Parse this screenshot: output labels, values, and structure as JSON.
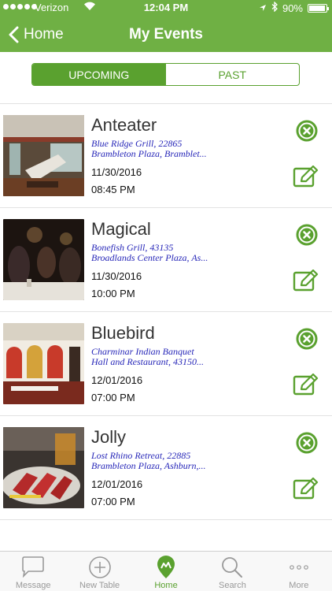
{
  "status_bar": {
    "carrier": "Verizon",
    "time": "12:04 PM",
    "battery": "90%"
  },
  "nav": {
    "back_label": "Home",
    "title": "My Events"
  },
  "segments": {
    "upcoming": "UPCOMING",
    "past": "PAST",
    "selected": "UPCOMING"
  },
  "events": [
    {
      "name": "Anteater",
      "address_line1": "Blue Ridge Grill, 22865",
      "address_line2": "Brambleton Plaza, Bramblet...",
      "date": "11/30/2016",
      "time": "08:45 PM"
    },
    {
      "name": "Magical",
      "address_line1": "Bonefish Grill, 43135",
      "address_line2": "Broadlands Center Plaza, As...",
      "date": "11/30/2016",
      "time": "10:00 PM"
    },
    {
      "name": "Bluebird",
      "address_line1": "Charminar Indian Banquet",
      "address_line2": "Hall and Restaurant, 43150...",
      "date": "12/01/2016",
      "time": "07:00 PM"
    },
    {
      "name": "Jolly",
      "address_line1": "Lost Rhino Retreat, 22885",
      "address_line2": "Brambleton Plaza, Ashburn,...",
      "date": "12/01/2016",
      "time": "07:00 PM"
    }
  ],
  "tabs": [
    {
      "label": "Message",
      "icon": "message-icon"
    },
    {
      "label": "New Table",
      "icon": "plus-circle-icon"
    },
    {
      "label": "Home",
      "icon": "map-pin-icon",
      "active": true
    },
    {
      "label": "Search",
      "icon": "search-icon"
    },
    {
      "label": "More",
      "icon": "more-dots-icon"
    }
  ],
  "colors": {
    "brand_green": "#6fb044",
    "accent_green": "#5aa12f",
    "address_blue": "#2626b8"
  }
}
